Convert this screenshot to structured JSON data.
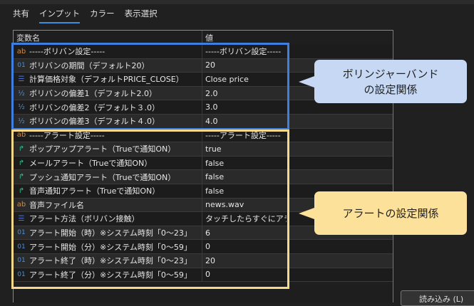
{
  "tabs": [
    "共有",
    "インプット",
    "カラー",
    "表示選択"
  ],
  "active_tab": "インプット",
  "table": {
    "headers": [
      "変数名",
      "値"
    ],
    "rows": [
      {
        "icon": "ab",
        "name": "-----ボリバン設定-----",
        "value": "-----ボリバン設定-----"
      },
      {
        "icon": "01",
        "name": "ボリバンの期間（デフォルト20）",
        "value": "20"
      },
      {
        "icon": "enum",
        "name": "計算価格対象（デフォルトPRICE_CLOSE）",
        "value": "Close price"
      },
      {
        "icon": "½",
        "name": "ボリバンの偏差1（デフォルト2.0）",
        "value": "2.0"
      },
      {
        "icon": "½",
        "name": "ボリバンの偏差2（デフォルト３.0）",
        "value": "3.0"
      },
      {
        "icon": "½",
        "name": "ボリバンの偏差3（デフォルト４.0）",
        "value": "4.0"
      },
      {
        "icon": "ab",
        "name": "-----アラート設定-----",
        "value": "-----アラート設定-----"
      },
      {
        "icon": "bool",
        "name": "ポップアップアラート（Trueで通知ON）",
        "value": "true"
      },
      {
        "icon": "bool",
        "name": "メールアラート（Trueで通知ON）",
        "value": "false"
      },
      {
        "icon": "bool",
        "name": "プッシュ通知アラート（Trueで通知ON）",
        "value": "false"
      },
      {
        "icon": "bool",
        "name": "音声通知アラート（Trueで通知ON）",
        "value": "false"
      },
      {
        "icon": "ab",
        "name": "音声ファイル名",
        "value": "news.wav"
      },
      {
        "icon": "enum",
        "name": "アラート方法（ボリバン接触）",
        "value": "タッチしたらすぐにアラート"
      },
      {
        "icon": "01",
        "name": "アラート開始（時）※システム時刻「0～23」",
        "value": "6"
      },
      {
        "icon": "01",
        "name": "アラート開始（分）※システム時刻「0～59」",
        "value": "0"
      },
      {
        "icon": "01",
        "name": "アラート終了（時）※システム時刻「0～23」",
        "value": "20"
      },
      {
        "icon": "01",
        "name": "アラート終了（分）※システム時刻「0～59」",
        "value": "0"
      }
    ]
  },
  "callouts": {
    "bollinger": "ボリンジャーバンド\nの設定関係",
    "alert": "アラートの設定関係"
  },
  "load_button": "読み込み (L)",
  "colors": {
    "accent": "#3b8fe0",
    "bollinger_box": "#3f7fe0",
    "alert_box": "#f6d88a"
  }
}
